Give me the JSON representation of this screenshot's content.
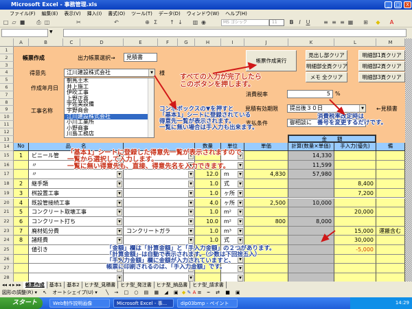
{
  "window": {
    "title": "Microsoft Excel - 事務管理.xls",
    "controls": [
      "_",
      "□",
      "X"
    ]
  },
  "menu": [
    "ファイル(F)",
    "編集(E)",
    "表示(V)",
    "挿入(I)",
    "書式(O)",
    "ツール(T)",
    "データ(D)",
    "ウィンドウ(W)",
    "ヘルプ(H)"
  ],
  "toolbar": {
    "font_name": "MS ゴシック",
    "font_size": "11"
  },
  "columns": [
    "A",
    "B",
    "C",
    "D",
    "E",
    "F",
    "G",
    "H",
    "I",
    "J",
    "K",
    "L",
    "M"
  ],
  "form": {
    "heading": "帳票作成",
    "output_label": "出力帳票選択→",
    "output_value": "見積書",
    "customer_label": "得意先",
    "customer_value": "江川建設株式会社",
    "customer_suffix": "様",
    "date_label": "作成年月日",
    "project_label": "工事名称",
    "customer_options": [
      "朝馬土木",
      "井上施工",
      "伊吹工事",
      "上野正喜",
      "宇佐美設備",
      "宇野商会",
      "江川建設株式会社",
      "小川工業所",
      "小野商事",
      "川島工務店"
    ],
    "selected_option": "江川建設株式会社",
    "run_button": "帳票作成実行",
    "clear_buttons": [
      "見出し部クリア",
      "明細部1頁クリア",
      "明細部全頁クリア",
      "明細部2頁クリア",
      "メモ 全クリア",
      "明細部3頁クリア"
    ],
    "tax_label": "消費税率",
    "tax_value": "5",
    "tax_unit": "%",
    "validity_label": "見積有効期限",
    "validity_value": "提出後３０日",
    "validity_note": "←見積書",
    "payment_label": "支払条件",
    "payment_value": "御相談に"
  },
  "table": {
    "amount_group": "金　　額",
    "headers": [
      "No",
      "品　　名",
      "数量",
      "単位",
      "単価",
      "計算(数量×単価)",
      "手入力(優先)",
      "備"
    ],
    "rows": [
      {
        "row": "15",
        "no": "1",
        "name": "ビニール管",
        "spec": "",
        "qty": "",
        "unit": "",
        "price": "",
        "calc": "14,330",
        "manual": "",
        "note": ""
      },
      {
        "row": "16",
        "no": "",
        "name": "〃",
        "spec": "",
        "qty": "",
        "unit": "",
        "price": "",
        "calc": "11,599",
        "manual": "",
        "note": ""
      },
      {
        "row": "17",
        "no": "",
        "name": "〃",
        "spec": "",
        "qty": "12.0",
        "unit": "m",
        "price": "4,830",
        "calc": "57,980",
        "manual": "",
        "note": ""
      },
      {
        "row": "18",
        "no": "2",
        "name": "継手類",
        "spec": "",
        "qty": "1.0",
        "unit": "式",
        "price": "",
        "calc": "",
        "manual": "8,400",
        "note": ""
      },
      {
        "row": "19",
        "no": "3",
        "name": "桝設置工事",
        "spec": "",
        "qty": "1.0",
        "unit": "ヶ所",
        "price": "",
        "calc": "",
        "manual": "7,200",
        "note": ""
      },
      {
        "row": "20",
        "no": "4",
        "name": "既設管接続工事",
        "spec": "",
        "qty": "4.0",
        "unit": "ヶ所",
        "price": "2,500",
        "calc": "10,000",
        "manual": "",
        "note": ""
      },
      {
        "row": "21",
        "no": "5",
        "name": "コンクリート取壊工事",
        "spec": "",
        "qty": "1.0",
        "unit": "m²",
        "price": "",
        "calc": "",
        "manual": "20,000",
        "note": ""
      },
      {
        "row": "22",
        "no": "6",
        "name": "コンクリート打ち",
        "spec": "",
        "qty": "10.0",
        "unit": "m²",
        "price": "800",
        "calc": "8,000",
        "manual": "",
        "note": ""
      },
      {
        "row": "23",
        "no": "7",
        "name": "廃材処分費",
        "spec": "コンクリートガラ",
        "qty": "1.0",
        "unit": "m³",
        "price": "",
        "calc": "",
        "manual": "15,000",
        "note": "運搬含む"
      },
      {
        "row": "24",
        "no": "8",
        "name": "諸経費",
        "spec": "",
        "qty": "1.0",
        "unit": "式",
        "price": "",
        "calc": "",
        "manual": "30,000",
        "note": ""
      },
      {
        "row": "25",
        "no": "",
        "name": "値引き",
        "spec": "",
        "qty": "",
        "unit": "",
        "price": "",
        "calc": "",
        "manual": "-5,000",
        "note": ""
      },
      {
        "row": "26",
        "no": "",
        "name": "",
        "spec": "",
        "qty": "",
        "unit": "",
        "price": "",
        "calc": "",
        "manual": "",
        "note": ""
      },
      {
        "row": "27",
        "no": "",
        "name": "",
        "spec": "",
        "qty": "",
        "unit": "",
        "price": "",
        "calc": "",
        "manual": "",
        "note": ""
      },
      {
        "row": "28",
        "no": "",
        "name": "",
        "spec": "",
        "qty": "",
        "unit": "",
        "price": "",
        "calc": "",
        "manual": "",
        "note": ""
      }
    ]
  },
  "annotations": {
    "run_note": [
      "すべての入力が完了したら",
      "このボタンを押します。"
    ],
    "combo_note": [
      "コンボボックスの▼を押すと",
      "「基本1」シートに登録されている",
      "得意先一覧が表示されます。",
      "一覧に無い場合は手入力も出来ます。"
    ],
    "tax_note": [
      "消費税率改定時は",
      "番号を変更するだけです。"
    ],
    "list_note": [
      "「基本1」シートに登録した得意先一覧が表示されますので",
      "一覧から選択して入力します。",
      "一覧に無い得意先も、直接、得意先名を入力できます。"
    ],
    "amount_note": [
      "「金額」欄は「計算金額」と「手入力金額」の２つがあります。",
      "「計算金額」は自動で表示されます。（少数は下回捨五入）",
      "「手入力金額」欄に金額が入力されていますと、",
      "帳票に印刷されるのは、「手入力金額」です。"
    ]
  },
  "sheet_tabs": [
    "帳票作成",
    "基本1",
    "基本2",
    "ヒナ型_見積書",
    "ヒナ型_発注書",
    "ヒナ型_納品書",
    "ヒナ型_請求書"
  ],
  "active_tab": "帳票作成",
  "drawing_toolbar": {
    "draw": "図形の調整(R) ▾",
    "autoshape": "オートシェイプ(U) ▾"
  },
  "taskbar": {
    "start": "スタート",
    "items": [
      "Web制作説明画像",
      "Microsoft Excel - 事...",
      "dip03bmp - ペイント"
    ],
    "clock": "14:29"
  },
  "colors": {
    "sheet_bg": "#fbc590",
    "header_blue": "#99ccff",
    "input_yellow": "#ffff99",
    "calc_gray": "#c0c0c0",
    "annotation_red": "#c8321a",
    "annotation_blue": "#1e3f9a",
    "selection": "#316ac5"
  }
}
